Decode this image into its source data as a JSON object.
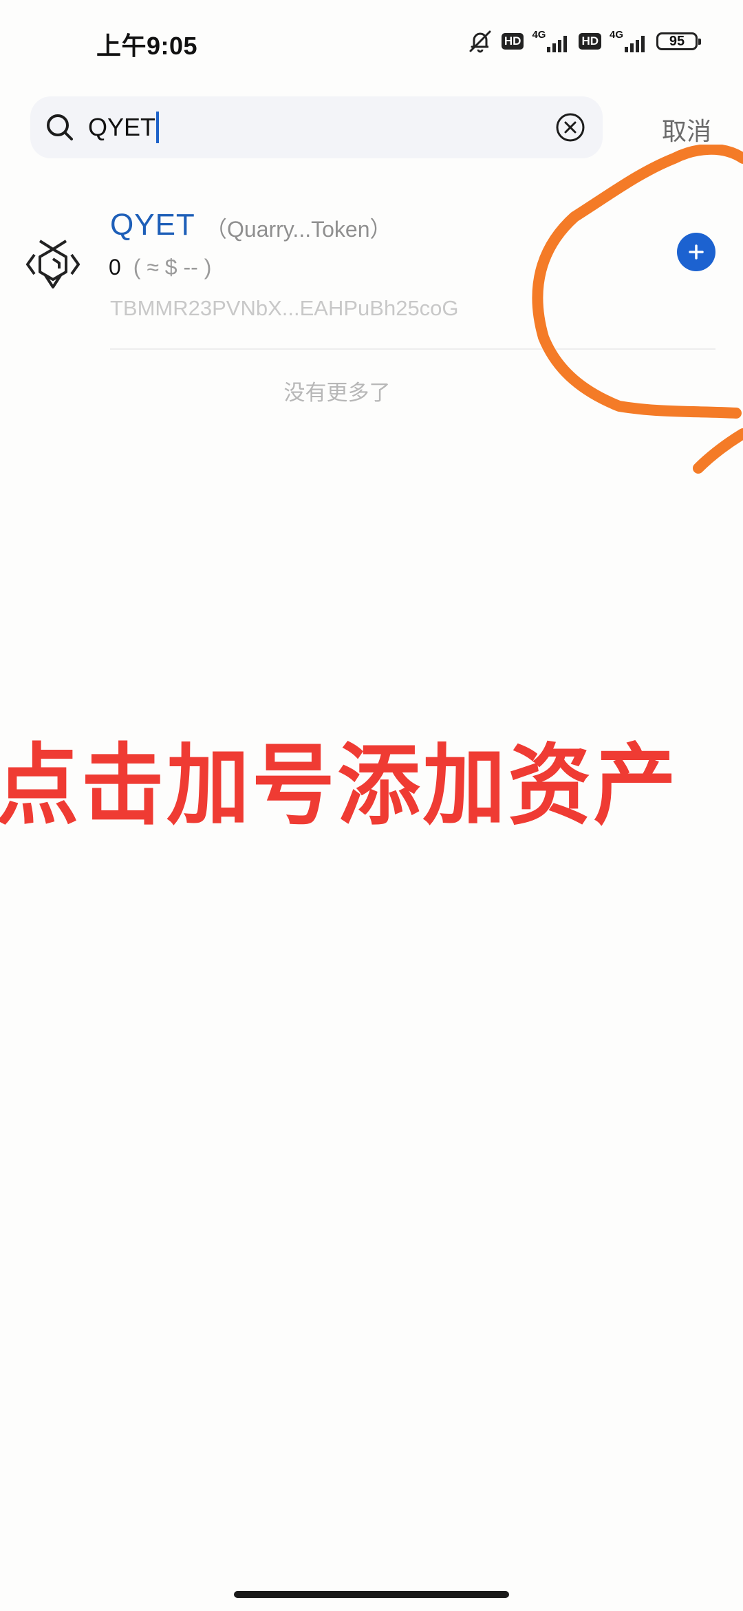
{
  "status_bar": {
    "time": "上午9:05",
    "hd_badge_1": "HD",
    "network_1": "4G",
    "hd_badge_2": "HD",
    "network_2": "4G",
    "battery": "95"
  },
  "search": {
    "query": "QYET",
    "cancel_label": "取消"
  },
  "token": {
    "symbol": "QYET",
    "name": "（Quarry...Token）",
    "balance": "0",
    "fiat": "( ≈ $ -- )",
    "address": "TBMMR23PVNbX...EAHPuBh25coG",
    "accent_color": "#1e5fb8",
    "add_button_color": "#1c62d0"
  },
  "list_end_text": "没有更多了",
  "annotation": {
    "caption": "点击加号添加资产",
    "caption_color": "#ef3b33",
    "circle_color": "#f47b27"
  }
}
